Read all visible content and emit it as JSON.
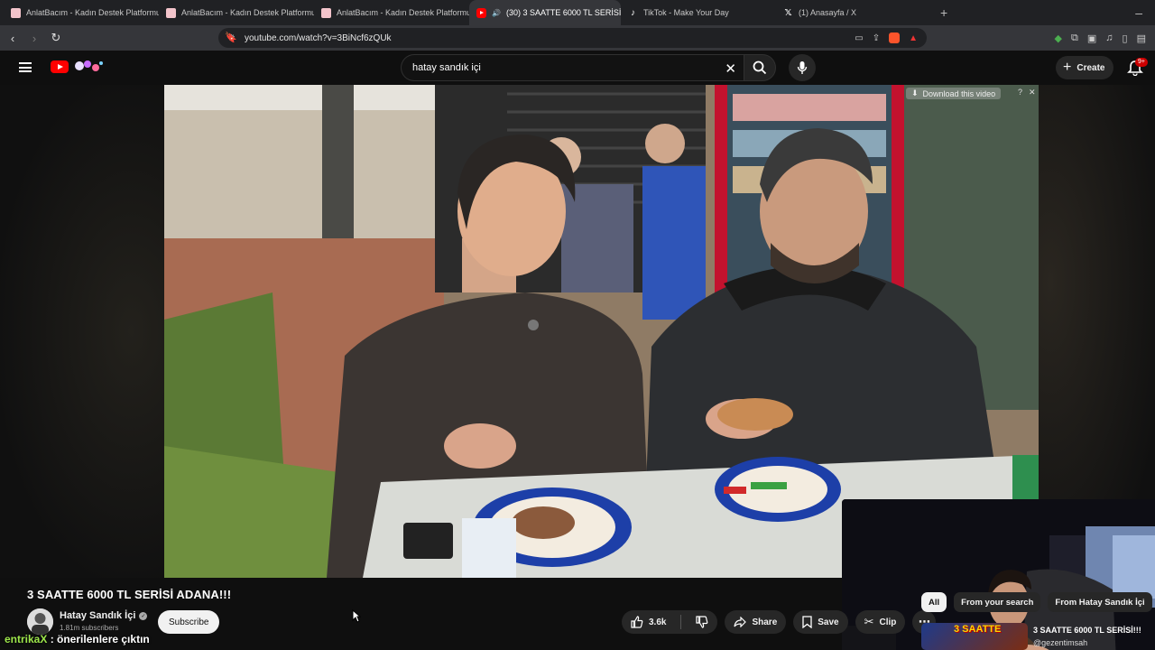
{
  "browser": {
    "tabs": [
      {
        "title": "AnlatBacım - Kadın Destek Platformu",
        "icon": "anlatbacim-favicon",
        "active": false
      },
      {
        "title": "AnlatBacım - Kadın Destek Platformu",
        "icon": "anlatbacim-favicon",
        "active": false
      },
      {
        "title": "AnlatBacım - Kadın Destek Platformu",
        "icon": "anlatbacim-favicon",
        "active": false
      },
      {
        "title": "(30) 3 SAATTE 6000 TL SERİSİ",
        "icon": "youtube-favicon",
        "active": true
      },
      {
        "title": "TikTok - Make Your Day",
        "icon": "tiktok-favicon",
        "active": false
      },
      {
        "title": "(1) Anasayfa / X",
        "icon": "x-favicon",
        "active": false
      }
    ],
    "url": "youtube.com/watch?v=3BiNcf6zQUk"
  },
  "masthead": {
    "search_query": "hatay sandık içi",
    "create_label": "Create",
    "notifications_badge": "9+"
  },
  "player": {
    "download_label": "Download this video"
  },
  "video": {
    "title": "3 SAATTE 6000 TL SERİSİ ADANA!!!",
    "channel": "Hatay Sandık İçi",
    "subscribers": "1.81m subscribers",
    "subscribe_label": "Subscribe",
    "likes": "3.6k",
    "share_label": "Share",
    "save_label": "Save",
    "clip_label": "Clip"
  },
  "stream_overlay": {
    "user": "entrikaX",
    "message": " : önerilenlere çıktın"
  },
  "sidebar": {
    "chips": [
      "All",
      "From your search",
      "From Hatay Sandık İçi"
    ],
    "selected_chip": "All",
    "recommendation": {
      "thumb_text": "3 SAATTE",
      "title": "3 SAATTE 6000 TL SERİSİ!!!",
      "channel": "@gezentimsah"
    }
  },
  "colors": {
    "youtube_red": "#ff0000",
    "background": "#0f0f0f",
    "chat_username": "#9de64b"
  }
}
